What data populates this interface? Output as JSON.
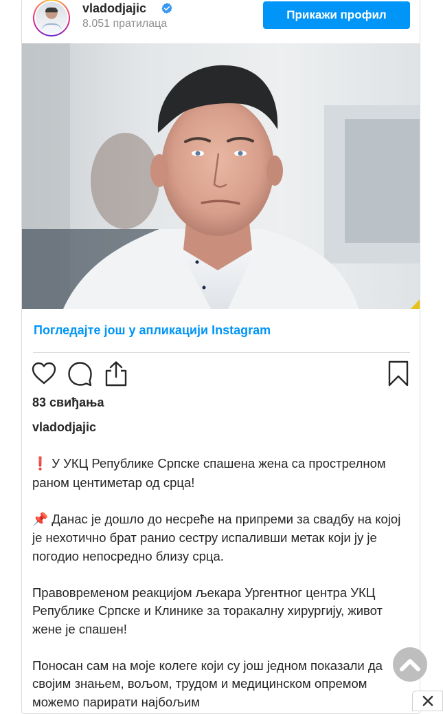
{
  "header": {
    "username": "vladodjajic",
    "followers": "8.051 пратилаца",
    "view_profile_label": "Прикажи профил"
  },
  "post": {
    "view_more_label": "Погледајте још у апликацији Instagram",
    "likes": "83 свиђања",
    "caption_user": "vladodjajic",
    "caption_paragraphs": [
      {
        "emoji": "❗",
        "text": "У УКЦ Републике Српске спашена жена са простреλном раном центиметар од срца!"
      },
      {
        "emoji": "📌",
        "text": "Данас је дошло до несреће на припреми за свадбу на којој је нехотично брат ранио сестру испаливши метак који ју је погодио непосредно близу срца."
      },
      {
        "emoji": "",
        "text": "Правовременом реакцијом љекара Ургентног центра УКЦ Републике Српске и Клинике за торакалну хирургију, живот жене је спашен!"
      },
      {
        "emoji": "",
        "text": "Поносан сам на моје колеге који су још једном показали да својим знањем, вољом, трудом и медицинском опремом можемо парирати најбољим"
      }
    ]
  },
  "icons": {
    "verified": "verified-badge-icon",
    "like": "heart-icon",
    "comment": "comment-icon",
    "share": "share-icon",
    "save": "bookmark-icon",
    "scroll_up": "chevron-up-icon",
    "close": "close-icon"
  },
  "colors": {
    "accent": "#0095f6",
    "text": "#262626",
    "muted": "#8e8e8e",
    "border": "#dbdbdb"
  }
}
